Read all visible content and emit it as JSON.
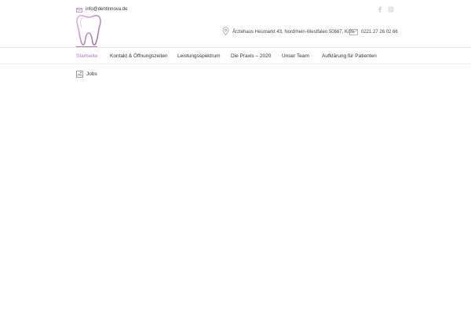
{
  "topbar": {
    "email": "info@dentinnova.de",
    "email_icon": "mail-icon",
    "social": [
      "facebook-icon",
      "instagram-icon"
    ]
  },
  "header": {
    "logo_icon": "tooth-logo",
    "address": "Ärztehaus Heumarkt 43, Nordrhein-Westfalen 50667, Köln",
    "address_icon": "map-pin-icon",
    "phone": "0221 27 26 02 66",
    "phone_icon": "envelope-icon"
  },
  "nav": {
    "items": [
      {
        "label": "Startseite",
        "active": true
      },
      {
        "label": "Kontakt & Öffnungszeiten"
      },
      {
        "label": "Leistungsspektrum"
      },
      {
        "label": "Die Praxis – 2020"
      },
      {
        "label": "Unser Team"
      },
      {
        "label": "Aufklärung für Patienten"
      }
    ]
  },
  "content": {
    "link_label": "Jobs",
    "link_icon": "document-image-icon"
  },
  "colors": {
    "accent": "#b07ac0",
    "text": "#333333",
    "divider": "#e8e8e8"
  }
}
